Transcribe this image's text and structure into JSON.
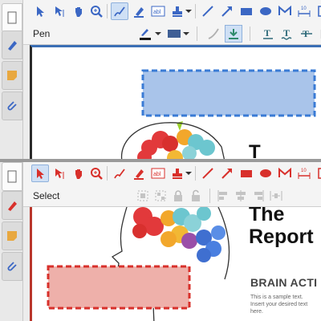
{
  "top_window": {
    "mode_label": "Pen",
    "sidebar_icons": [
      "stroke-pen-icon",
      "sticky-note-icon",
      "paperclip-icon"
    ],
    "annotation_color": "#3a7bd5",
    "rect_fill": "#a9c4ea",
    "toolbar_tools": [
      "select-icon",
      "text-select-icon",
      "hand-icon",
      "zoom-icon",
      "pen-icon",
      "highlighter-icon",
      "text-field-icon",
      "stamp-icon",
      "line-icon",
      "arrow-icon",
      "rectangle-icon",
      "ellipse-icon",
      "polygon-line-icon",
      "measure-icon"
    ],
    "title_partial": "T"
  },
  "bottom_window": {
    "mode_label": "Select",
    "sidebar_icons": [
      "stroke-pen-icon",
      "sticky-note-icon",
      "paperclip-icon"
    ],
    "annotation_color": "#d8302b",
    "rect_fill": "#eeb0aa",
    "document": {
      "title_line1": "The",
      "title_line2": "Report",
      "section_heading": "BRAIN ACTI",
      "body_line1": "This is a sample text.",
      "body_line2": "Insert your desired text here."
    }
  }
}
